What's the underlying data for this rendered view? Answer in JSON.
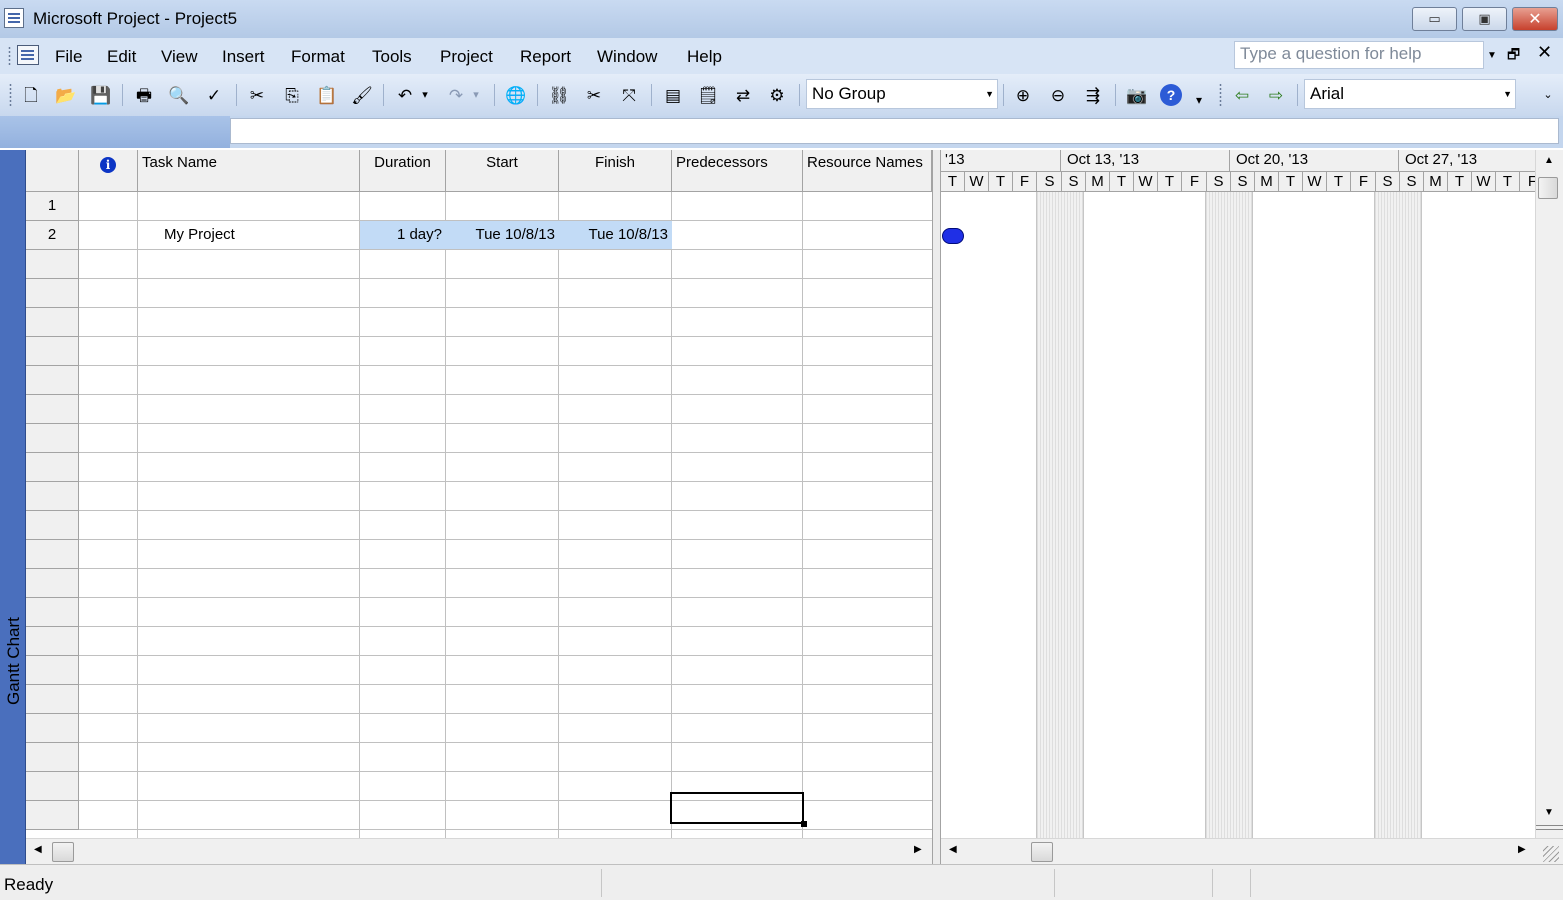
{
  "window": {
    "title": "Microsoft Project - Project5",
    "minimize": "▭",
    "maximize": "▣",
    "close": "✕"
  },
  "menu": {
    "items": [
      "File",
      "Edit",
      "View",
      "Insert",
      "Format",
      "Tools",
      "Project",
      "Report",
      "Window",
      "Help"
    ],
    "help_placeholder": "Type a question for help",
    "doc_restore": "🗗",
    "doc_close": "✕"
  },
  "toolbar": {
    "group_value": "No Group",
    "font_value": "Arial",
    "icons": [
      {
        "name": "new-icon",
        "glyph": "🗋"
      },
      {
        "name": "open-icon",
        "glyph": "📂"
      },
      {
        "name": "save-icon",
        "glyph": "💾"
      },
      {
        "name": "print-icon",
        "glyph": "🖶"
      },
      {
        "name": "print-preview-icon",
        "glyph": "🔍"
      },
      {
        "name": "spelling-icon",
        "glyph": "✓"
      },
      {
        "name": "cut-icon",
        "glyph": "✂"
      },
      {
        "name": "copy-icon",
        "glyph": "⎘"
      },
      {
        "name": "paste-icon",
        "glyph": "📋"
      },
      {
        "name": "format-painter-icon",
        "glyph": "🖌"
      },
      {
        "name": "undo-icon",
        "glyph": "↶"
      },
      {
        "name": "undo-dropdown-icon",
        "glyph": "▾"
      },
      {
        "name": "redo-icon",
        "glyph": "↷"
      },
      {
        "name": "redo-dropdown-icon",
        "glyph": "▾"
      },
      {
        "name": "hyperlink-icon",
        "glyph": "🌐"
      },
      {
        "name": "link-tasks-icon",
        "glyph": "⛓"
      },
      {
        "name": "unlink-tasks-icon",
        "glyph": "✂"
      },
      {
        "name": "split-task-icon",
        "glyph": "⤧"
      },
      {
        "name": "task-information-icon",
        "glyph": "▤"
      },
      {
        "name": "task-notes-icon",
        "glyph": "🗒"
      },
      {
        "name": "assign-resources-icon",
        "glyph": "⇄"
      },
      {
        "name": "publish-icon",
        "glyph": "⚙"
      },
      {
        "name": "zoom-in-icon",
        "glyph": "⊕"
      },
      {
        "name": "zoom-out-icon",
        "glyph": "⊖"
      },
      {
        "name": "scroll-to-task-icon",
        "glyph": "⇶"
      },
      {
        "name": "copy-picture-icon",
        "glyph": "📷"
      },
      {
        "name": "help-icon",
        "glyph": "?"
      },
      {
        "name": "toolbar-options-icon",
        "glyph": "▾"
      },
      {
        "name": "outdent-icon",
        "glyph": "⇦"
      },
      {
        "name": "indent-icon",
        "glyph": "⇨"
      }
    ]
  },
  "view_bar": {
    "label": "Gantt Chart"
  },
  "table": {
    "headers": {
      "info": "i",
      "task_name": "Task Name",
      "duration": "Duration",
      "start": "Start",
      "finish": "Finish",
      "predecessors": "Predecessors",
      "resource_names": "Resource Names"
    },
    "rows": [
      {
        "id": "1",
        "task_name": "",
        "duration": "",
        "start": "",
        "finish": "",
        "predecessors": "",
        "resource_names": ""
      },
      {
        "id": "2",
        "task_name": "My Project",
        "duration": "1 day?",
        "start": "Tue 10/8/13",
        "finish": "Tue 10/8/13",
        "predecessors": "",
        "resource_names": ""
      }
    ]
  },
  "gantt": {
    "weeks": [
      "'13",
      "Oct 13, '13",
      "Oct 20, '13",
      "Oct 27, '13"
    ],
    "days": [
      "T",
      "W",
      "T",
      "F",
      "S",
      "S",
      "M",
      "T",
      "W",
      "T",
      "F",
      "S",
      "S",
      "M",
      "T",
      "W",
      "T",
      "F",
      "S",
      "S",
      "M",
      "T",
      "W",
      "T",
      "F"
    ],
    "milestone_color": "#1f2fe6"
  },
  "status": {
    "text": "Ready"
  }
}
